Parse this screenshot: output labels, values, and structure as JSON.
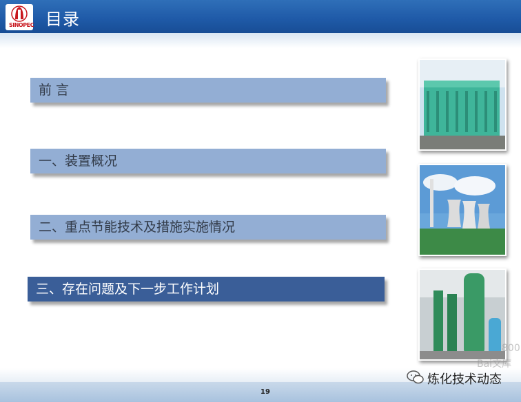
{
  "header": {
    "title": "目录",
    "logo_text": "SINOPEC"
  },
  "menu": {
    "items": [
      {
        "label": "前 言",
        "active": false
      },
      {
        "label": "一、装置概况",
        "active": false
      },
      {
        "label": "二、重点节能技术及措施实施情况",
        "active": false
      },
      {
        "label": "三、存在问题及下一步工作计划",
        "active": true
      }
    ]
  },
  "footer": {
    "page_number": "19",
    "wechat_label": "炼化技术动态"
  },
  "watermark": {
    "line1": "800",
    "line2": "Bai文库"
  },
  "colors": {
    "header": "#1f5aa8",
    "menu_item": "#93aed4",
    "menu_item_active": "#3a5e98",
    "brand_red": "#c8161d"
  }
}
